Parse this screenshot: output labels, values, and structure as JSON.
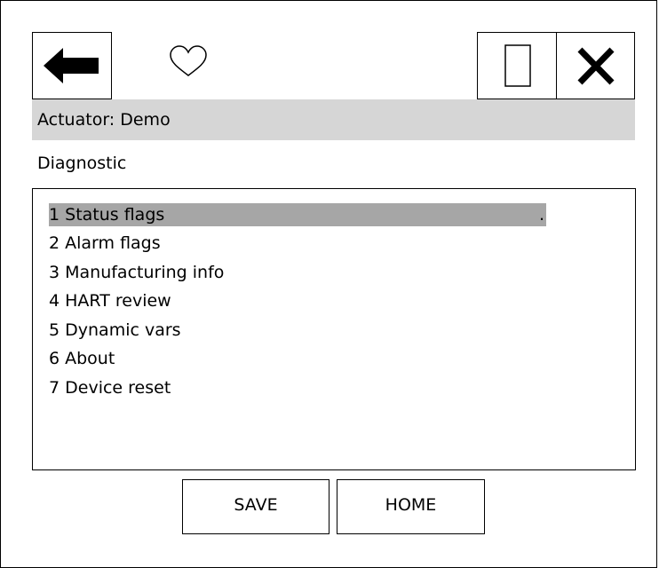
{
  "toolbar": {
    "back_icon": "left-arrow-icon",
    "favorite_icon": "heart-outline-icon",
    "window_icon": "window-restore-icon",
    "close_icon": "close-x-icon"
  },
  "header": {
    "actuator_label": "Actuator: Demo"
  },
  "section": {
    "title": "Diagnostic"
  },
  "menu": {
    "items": [
      {
        "label": "1 Status flags",
        "selected": true
      },
      {
        "label": "2 Alarm flags"
      },
      {
        "label": "3 Manufacturing info"
      },
      {
        "label": "4 HART review"
      },
      {
        "label": "5 Dynamic vars"
      },
      {
        "label": "6 About"
      },
      {
        "label": "7 Device reset"
      }
    ],
    "selected_marker": "."
  },
  "footer": {
    "save_label": "SAVE",
    "home_label": "HOME"
  },
  "colors": {
    "title_bar": "#d6d6d6",
    "selection": "#a6a6a6"
  }
}
